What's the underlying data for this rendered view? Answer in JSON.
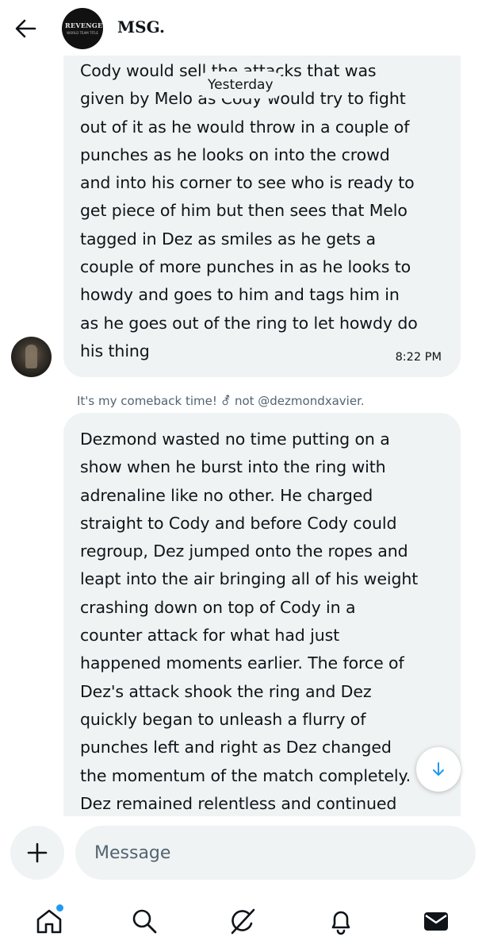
{
  "header": {
    "title": "MSG.",
    "avatar_logo_text": "REVENGE",
    "avatar_logo_sub": "WORLD TEAM TITLE"
  },
  "date_divider": "Yesterday",
  "messages": [
    {
      "lines": [
        "Cody would sell the attacks that was",
        "given by Melo as Cody would try to fight",
        "out of it as he would throw in a couple of",
        "punches as he looks on into the crowd",
        "and into his corner to see who is ready to",
        "get piece of him but then sees that Melo",
        "tagged in Dez as smiles as he gets a",
        "couple of more punches in as he looks to",
        "howdy and goes to him and tags him in",
        "as he goes out of the ring to let howdy do",
        "his thing"
      ],
      "time": "8:22 PM"
    },
    {
      "reply_header": "It's my comeback time! ⚦ not @dezmondxavier.",
      "lines": [
        "Dezmond wasted no time putting on a",
        "show when he burst into the ring with",
        "adrenaline like no other. He charged",
        "straight to Cody and before Cody could",
        "regroup, Dez jumped onto the ropes and",
        "leapt into the air bringing all of his weight",
        "crashing down on top of Cody in a",
        "counter attack for what had just",
        "happened moments earlier. The force of",
        "Dez's attack shook the ring and Dez",
        "quickly began to unleash a flurry of",
        "punches left and right as Dez changed",
        "the momentum of the match completely.",
        "Dez remained relentless and continued"
      ]
    }
  ],
  "composer": {
    "placeholder": "Message"
  },
  "nav": {
    "items": [
      "home-icon",
      "search-icon",
      "grok-icon",
      "bell-icon",
      "mail-icon"
    ],
    "accent_color": "#1d9bf0"
  }
}
